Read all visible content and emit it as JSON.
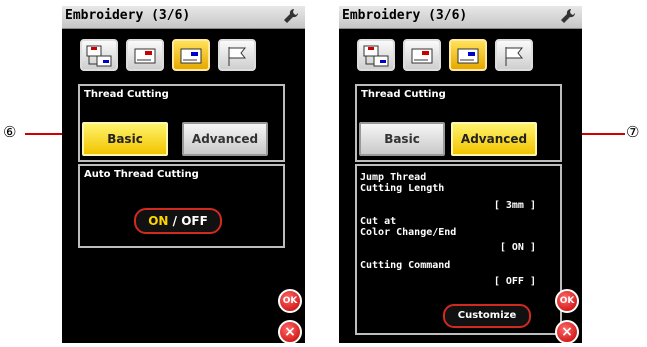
{
  "callouts": {
    "left": "⑥",
    "right": "⑦"
  },
  "screens": [
    {
      "title": "Embroidery (3/6)",
      "section_title": "Thread Cutting",
      "segments": {
        "basic": "Basic",
        "advanced": "Advanced",
        "selected": "Basic"
      },
      "auto_title": "Auto Thread Cutting",
      "toggle": {
        "on": "ON",
        "sep": " / ",
        "off": "OFF",
        "state": "ON"
      },
      "buttons": {
        "ok": "OK",
        "close": "×"
      }
    },
    {
      "title": "Embroidery (3/6)",
      "section_title": "Thread Cutting",
      "segments": {
        "basic": "Basic",
        "advanced": "Advanced",
        "selected": "Advanced"
      },
      "settings": [
        {
          "label1": "Jump Thread",
          "label2": "Cutting Length",
          "value": "[ 3mm ]"
        },
        {
          "label1": "Cut at",
          "label2": "Color Change/End",
          "value": "[ ON ]"
        },
        {
          "label1": "Cutting Command",
          "label2": "",
          "value": "[ OFF ]"
        }
      ],
      "customize_label": "Customize",
      "buttons": {
        "ok": "OK",
        "close": "×"
      }
    }
  ],
  "colors": {
    "highlight": "#f2c400",
    "accent_red": "#d12a1e",
    "background": "#000000"
  },
  "icons": [
    "wrench-icon",
    "embroidery-tab-1-icon",
    "embroidery-tab-2-icon",
    "embroidery-tab-3-icon",
    "flag-icon"
  ]
}
